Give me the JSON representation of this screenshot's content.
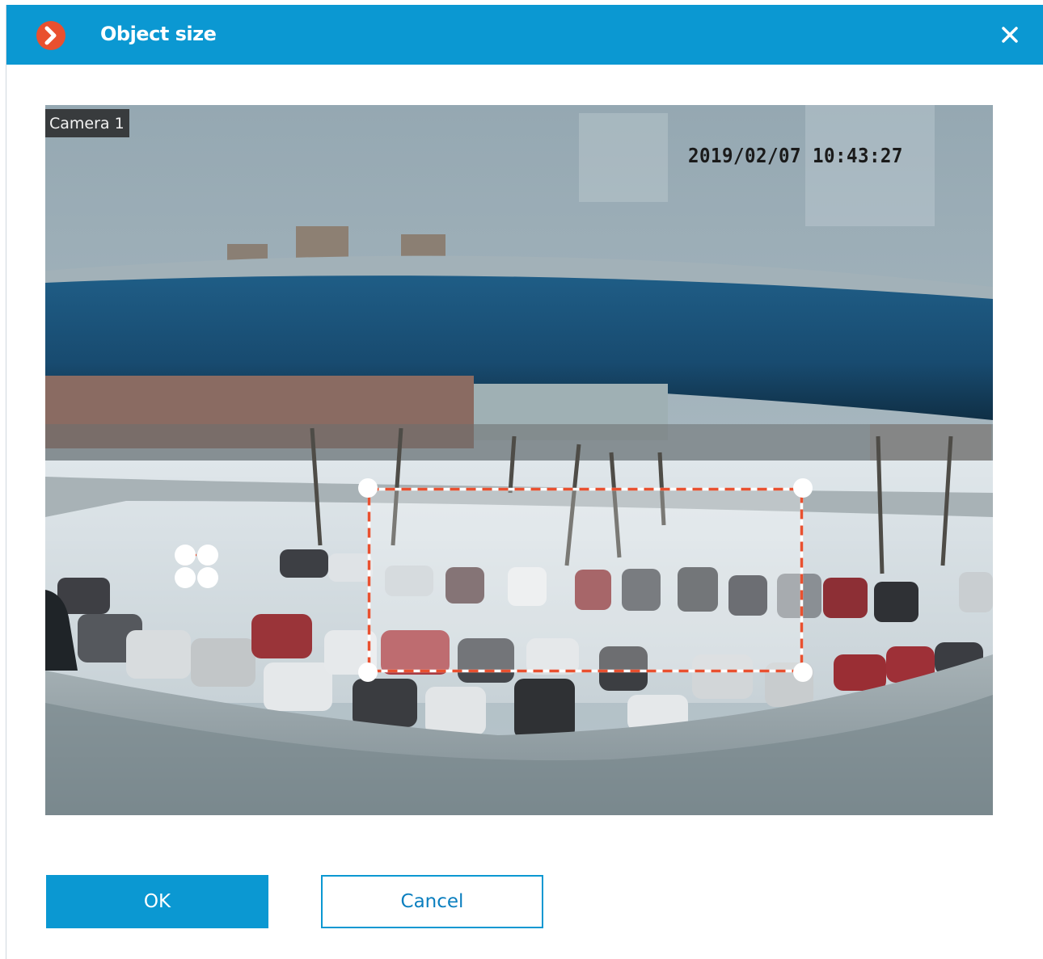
{
  "dialog": {
    "title": "Object size",
    "logo_icon": "miracle-chevron-logo-icon",
    "close_icon": "close-icon",
    "accent_color": "#0b98d2",
    "logo_color": "#e9502f"
  },
  "camera": {
    "label": "Camera 1",
    "timestamp": "2019/02/07 10:43:27"
  },
  "selection": {
    "stroke_colors": [
      "#ffffff",
      "#e9502f"
    ],
    "style": "dashed"
  },
  "buttons": {
    "ok_label": "OK",
    "cancel_label": "Cancel"
  }
}
